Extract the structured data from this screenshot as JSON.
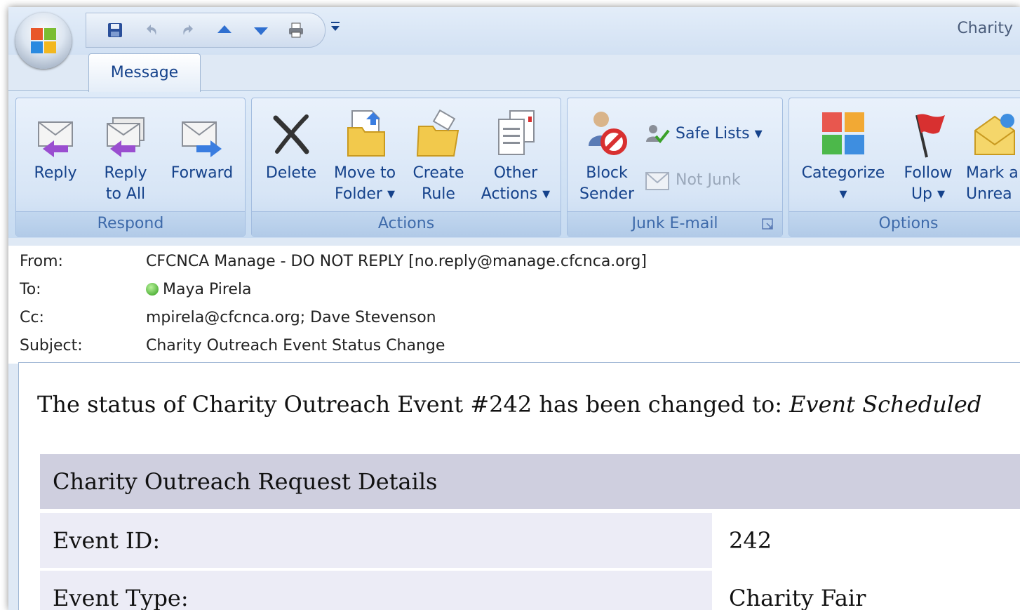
{
  "window": {
    "title": "Charity"
  },
  "ribbon": {
    "tab_message": "Message",
    "groups": {
      "respond": {
        "label": "Respond",
        "reply": "Reply",
        "reply_all_1": "Reply",
        "reply_all_2": "to All",
        "forward": "Forward"
      },
      "actions": {
        "label": "Actions",
        "delete": "Delete",
        "move_1": "Move to",
        "move_2": "Folder ▾",
        "rule_1": "Create",
        "rule_2": "Rule",
        "other_1": "Other",
        "other_2": "Actions ▾"
      },
      "junk": {
        "label": "Junk E-mail",
        "block_1": "Block",
        "block_2": "Sender",
        "safe_lists": "Safe Lists ▾",
        "not_junk": "Not Junk"
      },
      "options": {
        "label": "Options",
        "categorize": "Categorize",
        "categorize_arrow": "▾",
        "follow_1": "Follow",
        "follow_2": "Up ▾",
        "mark_1": "Mark a",
        "mark_2": "Unrea"
      }
    }
  },
  "header": {
    "from_label": "From:",
    "from_value": "CFCNCA Manage - DO NOT REPLY [no.reply@manage.cfcnca.org]",
    "to_label": "To:",
    "to_value": "Maya Pirela",
    "cc_label": "Cc:",
    "cc_value": "mpirela@cfcnca.org; Dave Stevenson",
    "subject_label": "Subject:",
    "subject_value": "Charity Outreach Event Status Change"
  },
  "message": {
    "status_prefix": "The status of Charity Outreach Event #242 has been changed to: ",
    "status_value": "Event Scheduled",
    "details_title": "Charity Outreach Request Details",
    "rows": [
      {
        "label": "Event ID:",
        "value": "242"
      },
      {
        "label": "Event Type:",
        "value": "Charity Fair"
      }
    ]
  }
}
